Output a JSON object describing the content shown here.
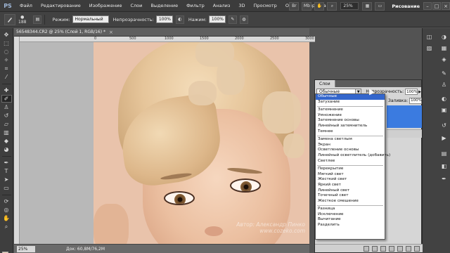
{
  "menubar": {
    "logo": "PS",
    "items": [
      "Файл",
      "Редактирование",
      "Изображение",
      "Слои",
      "Выделение",
      "Фильтр",
      "Анализ",
      "3D",
      "Просмотр",
      "Окно",
      "Справка"
    ],
    "zoom": "25%",
    "workspace": "Рисование",
    "win_controls": [
      "–",
      "□",
      "×"
    ]
  },
  "options": {
    "brush_size": "188",
    "mode_label": "Режим:",
    "mode_value": "Нормальный",
    "opacity_label": "Непрозрачность:",
    "opacity_value": "100%",
    "pressure_label": "Нажим:",
    "pressure_value": "100%"
  },
  "document": {
    "tab_title": "56548344.CR2 @ 25% (Слой 1, RGB/16) *",
    "close": "×",
    "ruler_numbers": [
      "0",
      "500",
      "1000",
      "1500",
      "2000",
      "2500",
      "3000",
      "3500"
    ],
    "status_zoom": "25%",
    "status_doc": "Док: 60,8M/76,2M",
    "watermark_line1": "Автор: Александр Пинко",
    "watermark_line2": "www.cozeko.com"
  },
  "layers_panel": {
    "tab": "Слои",
    "blend_value": "Обычные",
    "opacity_label": "Непрозрачность:",
    "opacity_value": "100%",
    "fill_label": "Заливка:",
    "fill_value": "100%"
  },
  "blend_modes": {
    "groups": [
      [
        "Обычные",
        "Затухание"
      ],
      [
        "Затемнение",
        "Умножение",
        "Затемнение основы",
        "Линейный затемнитель",
        "Темнее"
      ],
      [
        "Замена светлым",
        "Экран",
        "Осветление основы",
        "Линейный осветлитель (добавить)",
        "Светлее"
      ],
      [
        "Перекрытие",
        "Мягкий свет",
        "Жесткий свет",
        "Яркий свет",
        "Линейный свет",
        "Точечный свет",
        "Жесткое смешение"
      ],
      [
        "Разница",
        "Исключение",
        "Вычитание",
        "Разделить"
      ]
    ],
    "selected": "Обычные"
  },
  "colors": {
    "selection": "#3366cc",
    "layer_selected": "#3b7be0",
    "foreground_swatch": "#e9d3b8"
  }
}
